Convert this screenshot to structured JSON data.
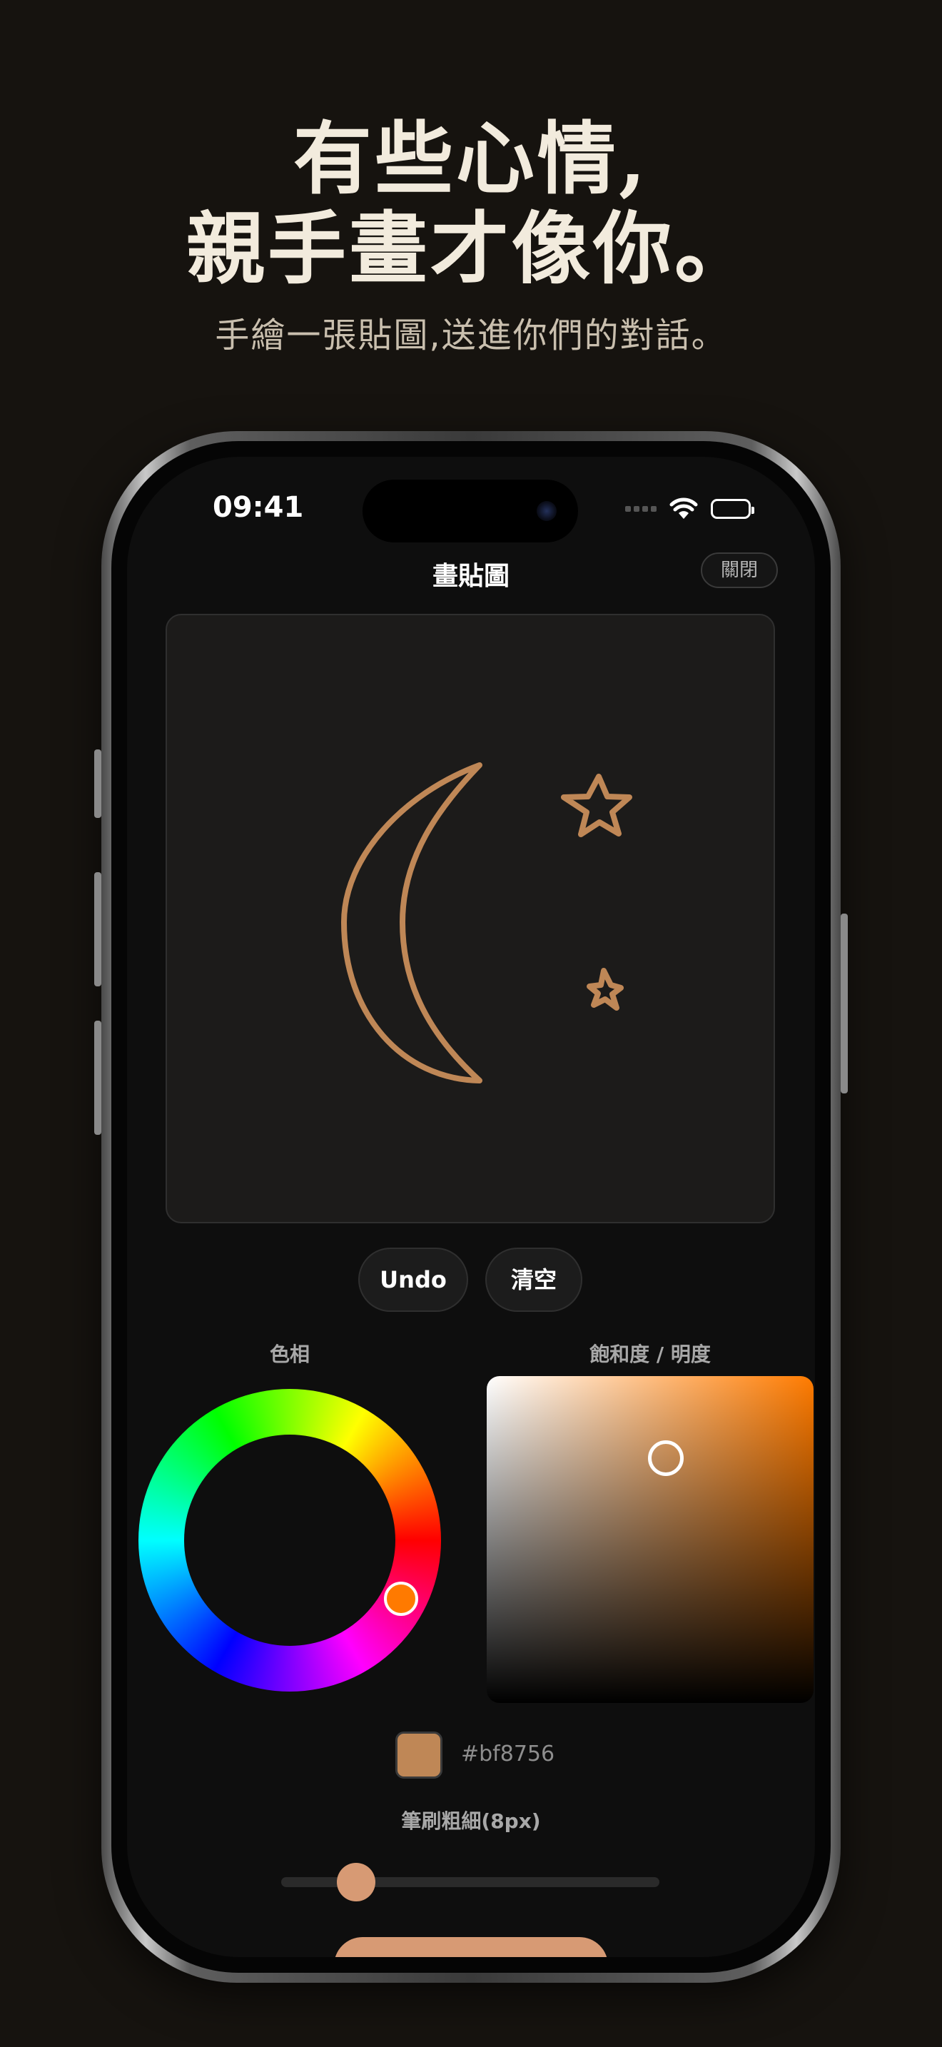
{
  "marketing": {
    "headline_line1": "有些心情,",
    "headline_line2": "親手畫才像你。",
    "subheadline": "手繪一張貼圖,送進你們的對話。"
  },
  "status_bar": {
    "time": "09:41",
    "icons": [
      "signal-icon",
      "wifi-icon",
      "battery-icon"
    ]
  },
  "nav": {
    "title": "畫貼圖",
    "close_label": "關閉"
  },
  "canvas": {
    "drawing": [
      "crescent-moon",
      "star",
      "small-star"
    ],
    "stroke_color": "#bf8756"
  },
  "actions": {
    "undo_label": "Undo",
    "clear_label": "清空"
  },
  "color_picker": {
    "hue_label": "色相",
    "sv_label": "飽和度 / 明度",
    "hue_color": "#ff7b00"
  },
  "current_color": {
    "hex_label": "#bf8756",
    "swatch_color": "#bf8756"
  },
  "brush": {
    "label": "筆刷粗細(8px)",
    "size": 8
  },
  "colors": {
    "background": "#16130f",
    "accent": "#d79a74",
    "headline": "#f2ebdd"
  }
}
